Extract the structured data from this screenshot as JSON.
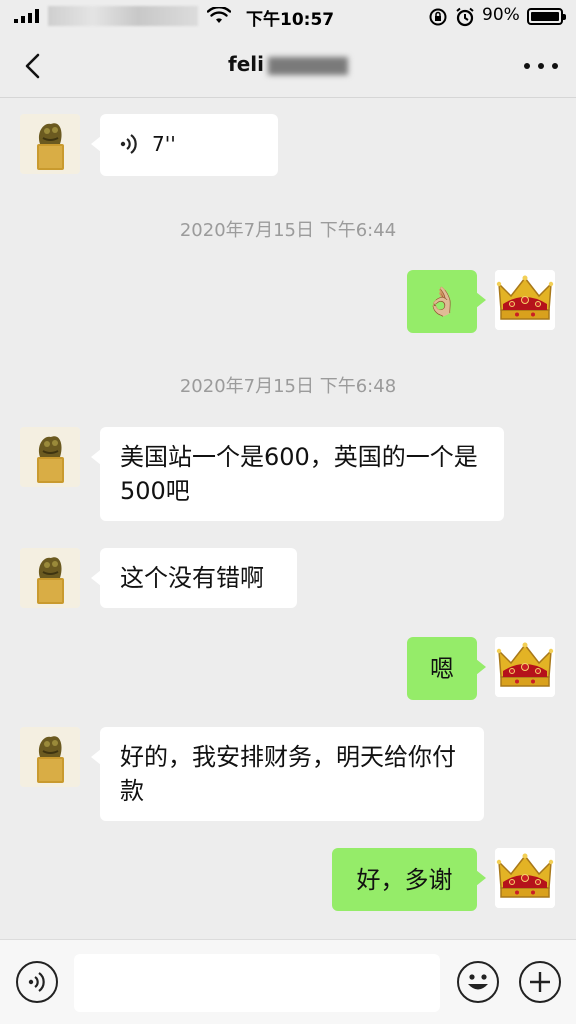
{
  "status_bar": {
    "time": "下午10:57",
    "battery": "90%"
  },
  "nav": {
    "title": "feli",
    "back_icon": "chevron-left-icon",
    "more_icon": "more-dots-icon"
  },
  "messages": [
    {
      "side": "in",
      "type": "voice",
      "duration": "7''"
    },
    {
      "side": "time",
      "text": "2020年7月15日 下午6:44"
    },
    {
      "side": "out",
      "type": "emoji",
      "emoji": "👌🏼"
    },
    {
      "side": "time",
      "text": "2020年7月15日 下午6:48"
    },
    {
      "side": "in",
      "text": "美国站一个是600，英国的一个是500吧"
    },
    {
      "side": "in",
      "text": "这个没有错啊"
    },
    {
      "side": "out",
      "text": "嗯"
    },
    {
      "side": "in",
      "text": "好的，我安排财务，明天给你付款"
    },
    {
      "side": "out",
      "text": "好，多谢"
    }
  ],
  "input": {
    "value": "",
    "placeholder": ""
  },
  "colors": {
    "background": "#ededed",
    "out_bubble": "#95ec69",
    "in_bubble": "#ffffff"
  }
}
